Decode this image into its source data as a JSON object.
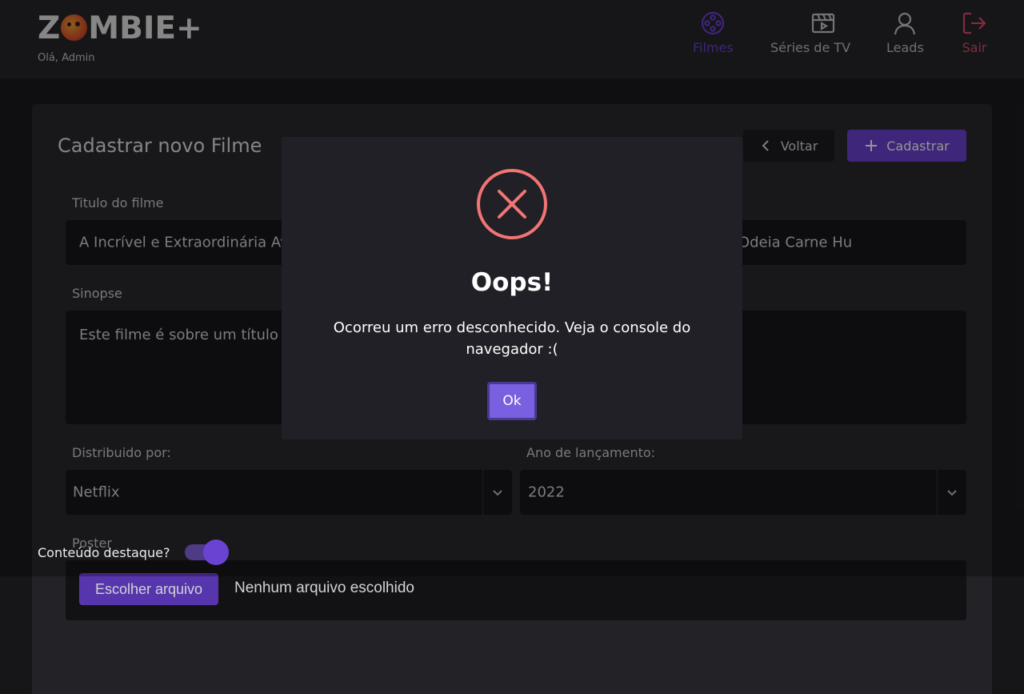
{
  "header": {
    "logo_prefix": "Z",
    "logo_suffix": "MBIE+",
    "greeting": "Olá, Admin",
    "nav": {
      "filmes": "Filmes",
      "series": "Séries de TV",
      "leads": "Leads",
      "sair": "Sair"
    }
  },
  "form": {
    "title": "Cadastrar novo Filme",
    "back_label": "Voltar",
    "submit_label": "Cadastrar",
    "title_label": "Titulo do filme",
    "title_value": "A Incrível e Extraordinária Aventura do Zumbi Vegetariano que Adorava Alface e Brócolis e Odeia Carne Hu",
    "synopsis_label": "Sinopse",
    "synopsis_value": "Este filme é sobre um título com um nome muito grande",
    "distributor_label": "Distribuido por:",
    "distributor_value": "Netflix",
    "year_label": "Ano de lançamento:",
    "year_value": "2022",
    "poster_label": "Poster",
    "file_button": "Escolher arquivo",
    "file_status": "Nenhum arquivo escolhido",
    "featured_label": "Conteúdo destaque?",
    "featured_on": true
  },
  "dialog": {
    "icon": "error-x-icon",
    "title": "Oops!",
    "message": "Ocorreu um erro desconhecido. Veja o console do navegador :(",
    "ok_label": "Ok"
  },
  "colors": {
    "accent": "#6b43d3",
    "error": "#f27474",
    "logout": "#e04d6a"
  }
}
